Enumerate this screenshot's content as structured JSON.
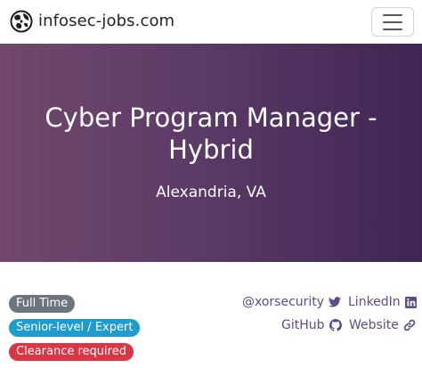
{
  "navbar": {
    "brand": "infosec-jobs.com",
    "logo_icon": "infosec-jobs-logo-icon",
    "menu_icon": "hamburger-menu-icon"
  },
  "hero": {
    "title": "Cyber Program Manager - Hybrid",
    "location": "Alexandria, VA",
    "gradient_start": "#71486c",
    "gradient_end": "#3f2553"
  },
  "badges": [
    {
      "label": "Full Time",
      "color": "#6c757d"
    },
    {
      "label": "Senior-level / Expert",
      "color": "#1d9ccd"
    },
    {
      "label": "Clearance required",
      "color": "#dc3545"
    }
  ],
  "links": {
    "twitter": {
      "label": "@xorsecurity",
      "icon": "twitter-icon"
    },
    "linkedin": {
      "label": "LinkedIn",
      "icon": "linkedin-icon"
    },
    "github": {
      "label": "GitHub",
      "icon": "github-icon"
    },
    "website": {
      "label": "Website",
      "icon": "link-icon"
    },
    "color": "#5f4b8b"
  }
}
